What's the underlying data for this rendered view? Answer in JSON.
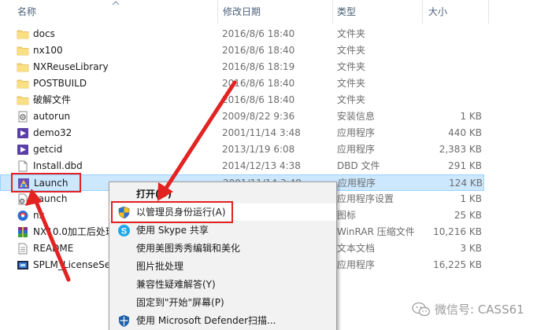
{
  "columns": {
    "name": "名称",
    "date": "修改日期",
    "type": "类型",
    "size": "大小"
  },
  "rows": [
    {
      "name": "docs",
      "date": "2016/8/6 18:40",
      "type": "文件夹",
      "size": "",
      "icon": "folder-icon"
    },
    {
      "name": "nx100",
      "date": "2016/8/6 18:40",
      "type": "文件夹",
      "size": "",
      "icon": "folder-icon"
    },
    {
      "name": "NXReuseLibrary",
      "date": "2016/8/6 18:19",
      "type": "文件夹",
      "size": "",
      "icon": "folder-icon"
    },
    {
      "name": "POSTBUILD",
      "date": "2016/8/6 18:40",
      "type": "文件夹",
      "size": "",
      "icon": "folder-icon"
    },
    {
      "name": "破解文件",
      "date": "2016/8/6 18:40",
      "type": "文件夹",
      "size": "",
      "icon": "folder-icon"
    },
    {
      "name": "autorun",
      "date": "2009/8/22 9:36",
      "type": "安装信息",
      "size": "1 KB",
      "icon": "setup-info-icon"
    },
    {
      "name": "demo32",
      "date": "2001/11/14 3:48",
      "type": "应用程序",
      "size": "440 KB",
      "icon": "app-icon"
    },
    {
      "name": "getcid",
      "date": "2013/1/19 6:08",
      "type": "应用程序",
      "size": "2,383 KB",
      "icon": "app-icon"
    },
    {
      "name": "Install.dbd",
      "date": "2014/12/13 4:38",
      "type": "DBD 文件",
      "size": "291 KB",
      "icon": "file-icon"
    },
    {
      "name": "Launch",
      "date": "2001/11/14 3:48",
      "type": "应用程序",
      "size": "124 KB",
      "icon": "launch-app-icon"
    },
    {
      "name": "Launch",
      "date": "",
      "type": "应用程序设置",
      "size": "1 KB",
      "icon": "settings-file-icon"
    },
    {
      "name": "nx",
      "date": "",
      "type": "图标",
      "size": "25 KB",
      "icon": "nx-icon"
    },
    {
      "name": "NX10.0加工后处理",
      "date": "",
      "type": "WinRAR 压缩文件",
      "size": "10,216 KB",
      "icon": "winrar-icon"
    },
    {
      "name": "README",
      "date": "",
      "type": "文本文档",
      "size": "3 KB",
      "icon": "text-file-icon"
    },
    {
      "name": "SPLM_LicenseServer",
      "date": "",
      "type": "应用程序",
      "size": "16,225 KB",
      "icon": "license-app-icon"
    }
  ],
  "selected_row": 9,
  "context_menu": {
    "items": [
      {
        "label": "打开(O)",
        "bold": true,
        "icon": ""
      },
      {
        "label": "以管理员身份运行(A)",
        "bold": false,
        "icon": "uac-shield-icon"
      },
      {
        "label": "使用 Skype 共享",
        "bold": false,
        "icon": "skype-icon"
      },
      {
        "label": "使用美图秀秀编辑和美化",
        "bold": false,
        "icon": ""
      },
      {
        "label": "图片批处理",
        "bold": false,
        "icon": ""
      },
      {
        "label": "兼容性疑难解答(Y)",
        "bold": false,
        "icon": ""
      },
      {
        "label": "固定到\"开始\"屏幕(P)",
        "bold": false,
        "icon": ""
      },
      {
        "label": "使用 Microsoft Defender扫描...",
        "bold": false,
        "icon": "defender-icon"
      }
    ],
    "highlighted": 1
  },
  "watermark": "微信号: CASS61",
  "colors": {
    "selection": "#cce8ff",
    "annotation": "#e32222",
    "folder": "#f8d775",
    "header_text": "#4c607a"
  }
}
